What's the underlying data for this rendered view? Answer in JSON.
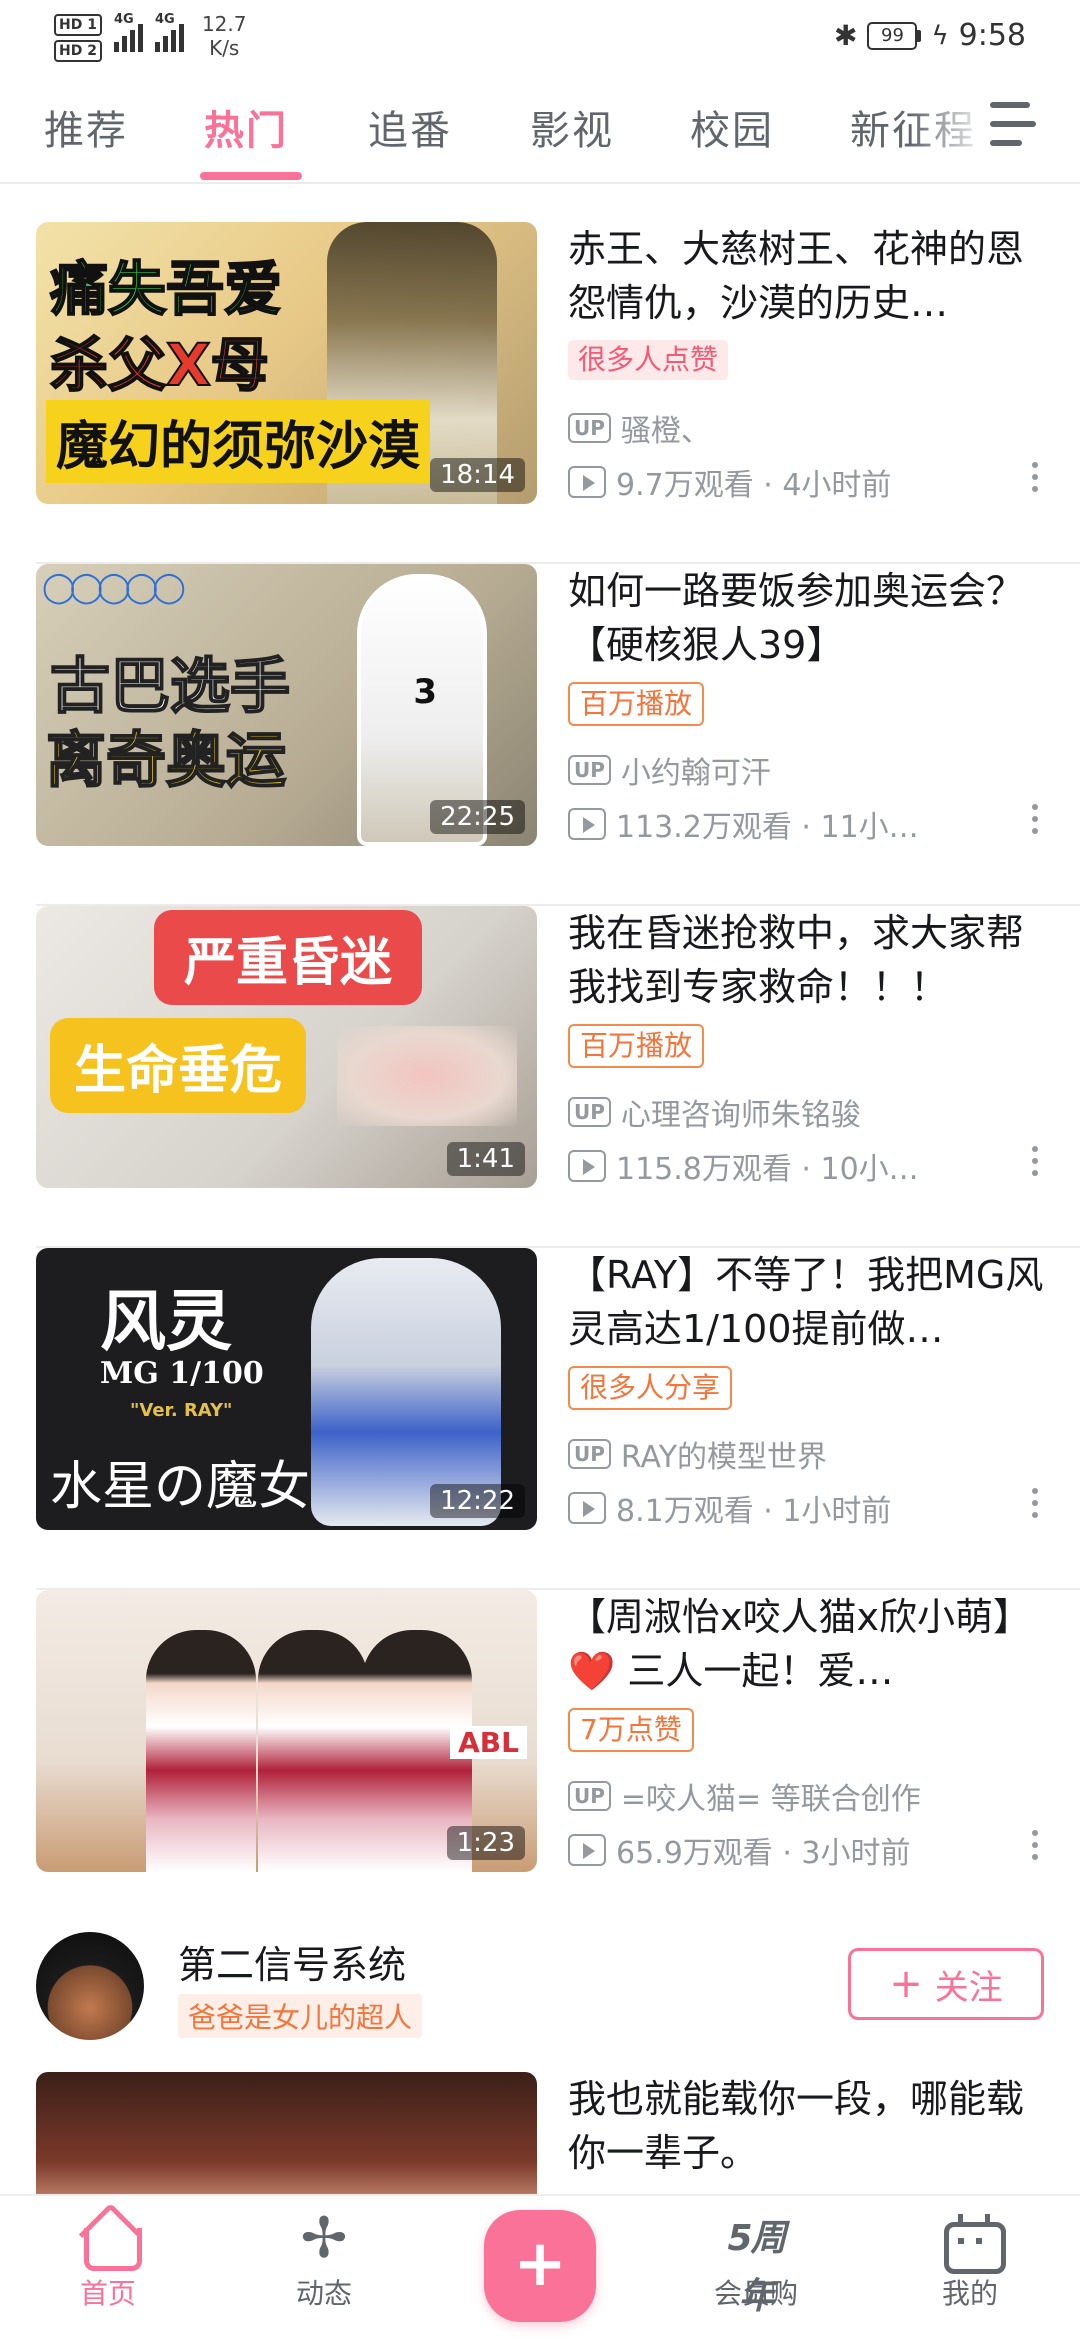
{
  "status_bar": {
    "hd1": "HD 1",
    "hd2": "HD 2",
    "net1": "4G",
    "net2": "4G",
    "speed_value": "12.7",
    "speed_unit": "K/s",
    "bluetooth_icon": "bluetooth-icon",
    "battery": "99",
    "time": "9:58"
  },
  "tabs": [
    {
      "label": "推荐"
    },
    {
      "label": "热门",
      "active": true
    },
    {
      "label": "追番"
    },
    {
      "label": "影视"
    },
    {
      "label": "校园"
    },
    {
      "label": "新征程"
    }
  ],
  "videos": [
    {
      "title": "赤王、大慈树王、花神的恩怨情仇，沙漠的历史…",
      "badge": "很多人点赞",
      "badge_style": "fill",
      "uploader": "骚橙、",
      "views": "9.7万观看 · 4小时前",
      "duration": "18:14",
      "thumb_text": [
        "痛失吾爱",
        "杀父X母",
        "魔幻的须弥沙漠"
      ]
    },
    {
      "title": "如何一路要饭参加奥运会？【硬核狠人39】",
      "badge": "百万播放",
      "badge_style": "outline",
      "uploader": "小约翰可汗",
      "views": "113.2万观看 · 11小…",
      "duration": "22:25",
      "thumb_text": [
        "古巴选手",
        "离奇奥运",
        "3"
      ]
    },
    {
      "title": "我在昏迷抢救中，求大家帮我找到专家救命！！！",
      "badge": "百万播放",
      "badge_style": "outline",
      "uploader": "心理咨询师朱铭骏",
      "views": "115.8万观看 · 10小…",
      "duration": "1:41",
      "thumb_text": [
        "严重昏迷",
        "生命垂危"
      ]
    },
    {
      "title": "【RAY】不等了！我把MG风灵高达1/100提前做…",
      "badge": "很多人分享",
      "badge_style": "outline",
      "uploader": "RAY的模型世界",
      "views": "8.1万观看 · 1小时前",
      "duration": "12:22",
      "thumb_text": [
        "风灵",
        "MG 1/100",
        "\"Ver. RAY\"",
        "水星の魔女"
      ]
    },
    {
      "title": "【周淑怡x咬人猫x欣小萌】❤️ 三人一起！爱…",
      "badge": "7万点赞",
      "badge_style": "outline",
      "uploader": "=咬人猫= 等联合创作",
      "views": "65.9万观看 · 3小时前",
      "duration": "1:23",
      "thumb_text": [
        "ABL"
      ]
    }
  ],
  "up_section": {
    "name": "第二信号系统",
    "desc": "爸爸是女儿的超人",
    "follow_label": "关注",
    "follow_plus": "+"
  },
  "partial_video": {
    "title": "我也就能载你一段，哪能载你一辈子。"
  },
  "bottom_nav": {
    "home": "首页",
    "dynamic": "动态",
    "publish": "+",
    "vip": "会员购",
    "vip_icon_text": "5周年",
    "mine": "我的"
  },
  "colors": {
    "accent": "#fb7299",
    "badge_fill_bg": "#fde8ea",
    "badge_fill_text": "#f45a73",
    "badge_outline": "#f4743a",
    "meta_text": "#9499a0"
  }
}
